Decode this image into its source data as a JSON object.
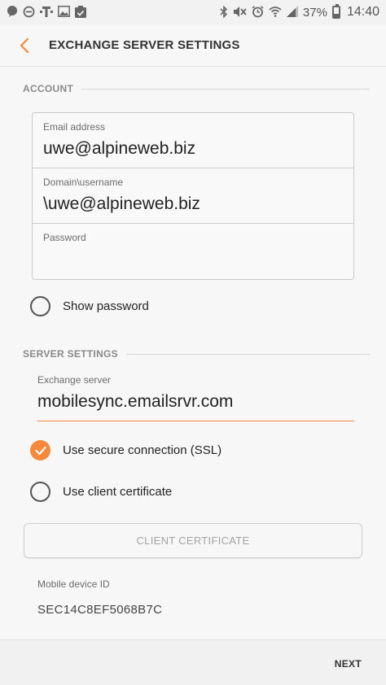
{
  "status_bar": {
    "left_icons": [
      "chat-bubble-icon",
      "do-not-disturb-icon",
      "t-mobile-icon",
      "image-icon",
      "clipboard-check-icon"
    ],
    "right_icons": [
      "bluetooth-icon",
      "mute-icon",
      "alarm-icon",
      "wifi-icon",
      "signal-icon"
    ],
    "battery_percent": "37%",
    "time": "14:40"
  },
  "header": {
    "title": "EXCHANGE SERVER SETTINGS",
    "accent_color": "#f5883a"
  },
  "account": {
    "section_title": "ACCOUNT",
    "email_label": "Email address",
    "email_value": "uwe@alpineweb.biz",
    "domain_label": "Domain\\username",
    "domain_value": "\\uwe@alpineweb.biz",
    "password_label": "Password",
    "password_value": "",
    "show_password_label": "Show password",
    "show_password_checked": false
  },
  "server_settings": {
    "section_title": "SERVER SETTINGS",
    "exchange_label": "Exchange server",
    "exchange_value": "mobilesync.emailsrvr.com",
    "ssl_label": "Use secure connection (SSL)",
    "ssl_checked": true,
    "client_cert_label": "Use client certificate",
    "client_cert_checked": false,
    "client_cert_button": "CLIENT CERTIFICATE",
    "device_id_label": "Mobile device ID",
    "device_id_value": "SEC14C8EF5068B7C"
  },
  "footer": {
    "next_label": "NEXT"
  }
}
